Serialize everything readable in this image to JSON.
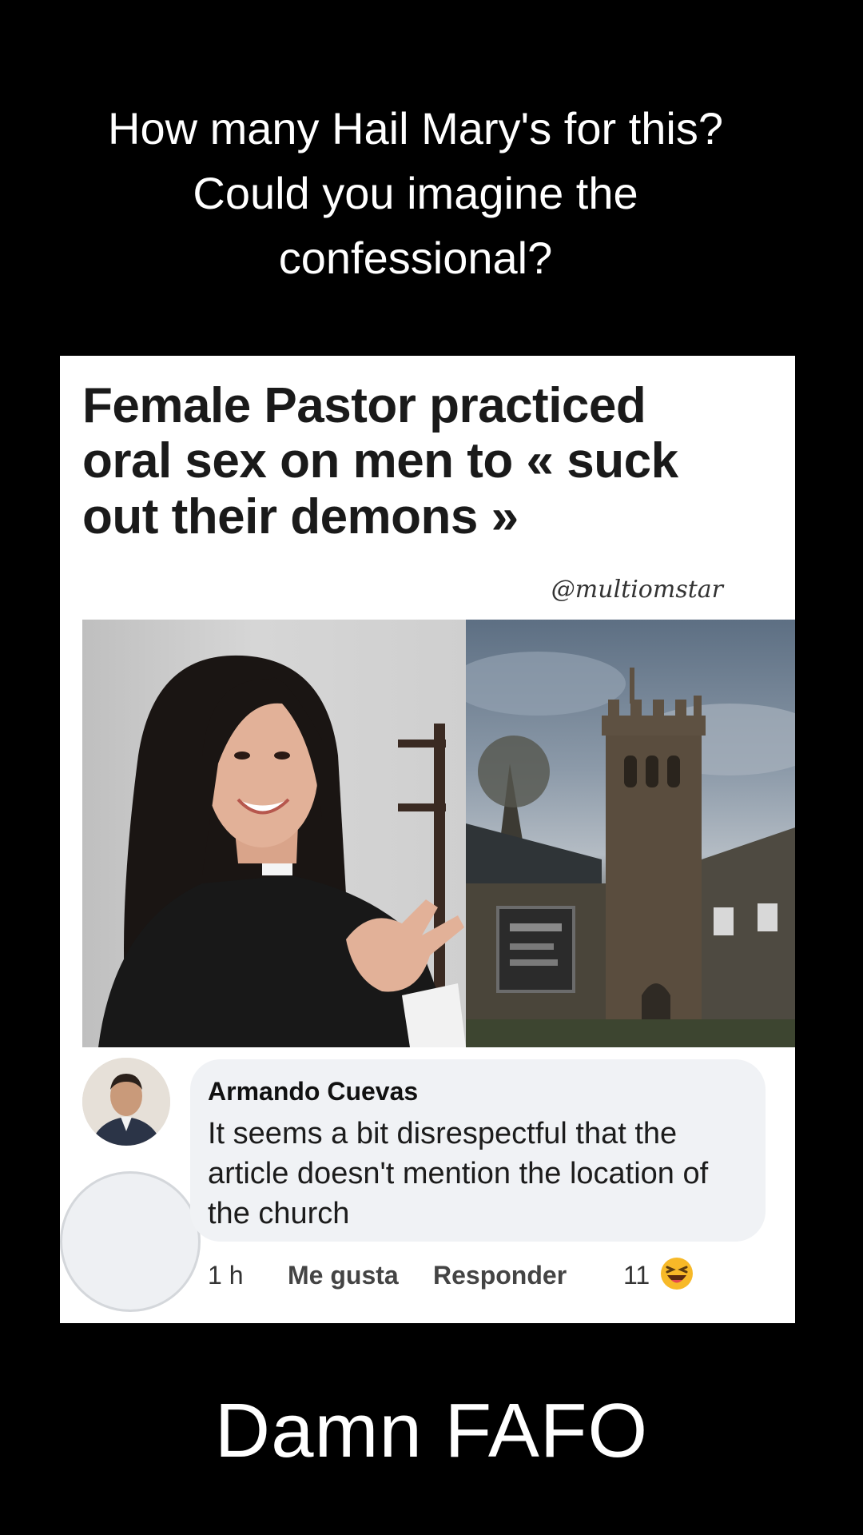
{
  "caption_top": {
    "line1": "How many Hail Mary's for this?",
    "line2": "Could you imagine the",
    "line3": "confessional?"
  },
  "post": {
    "headline": {
      "line1": "Female Pastor practiced",
      "line2": "oral sex on men to « suck",
      "line3": "out their demons »"
    },
    "watermark": "@multiomstar",
    "comment": {
      "author": "Armando Cuevas",
      "text": "It seems a bit disrespectful that the article doesn't mention the location of the church",
      "time": "1 h",
      "like_label": "Me gusta",
      "reply_label": "Responder",
      "reaction_count": "11",
      "reaction_icon": "laughing-emoji-icon"
    }
  },
  "caption_bottom": "Damn FAFO",
  "colors": {
    "background": "#000000",
    "card": "#ffffff",
    "comment_bubble": "#f0f2f5",
    "reaction": "#f7b928"
  }
}
